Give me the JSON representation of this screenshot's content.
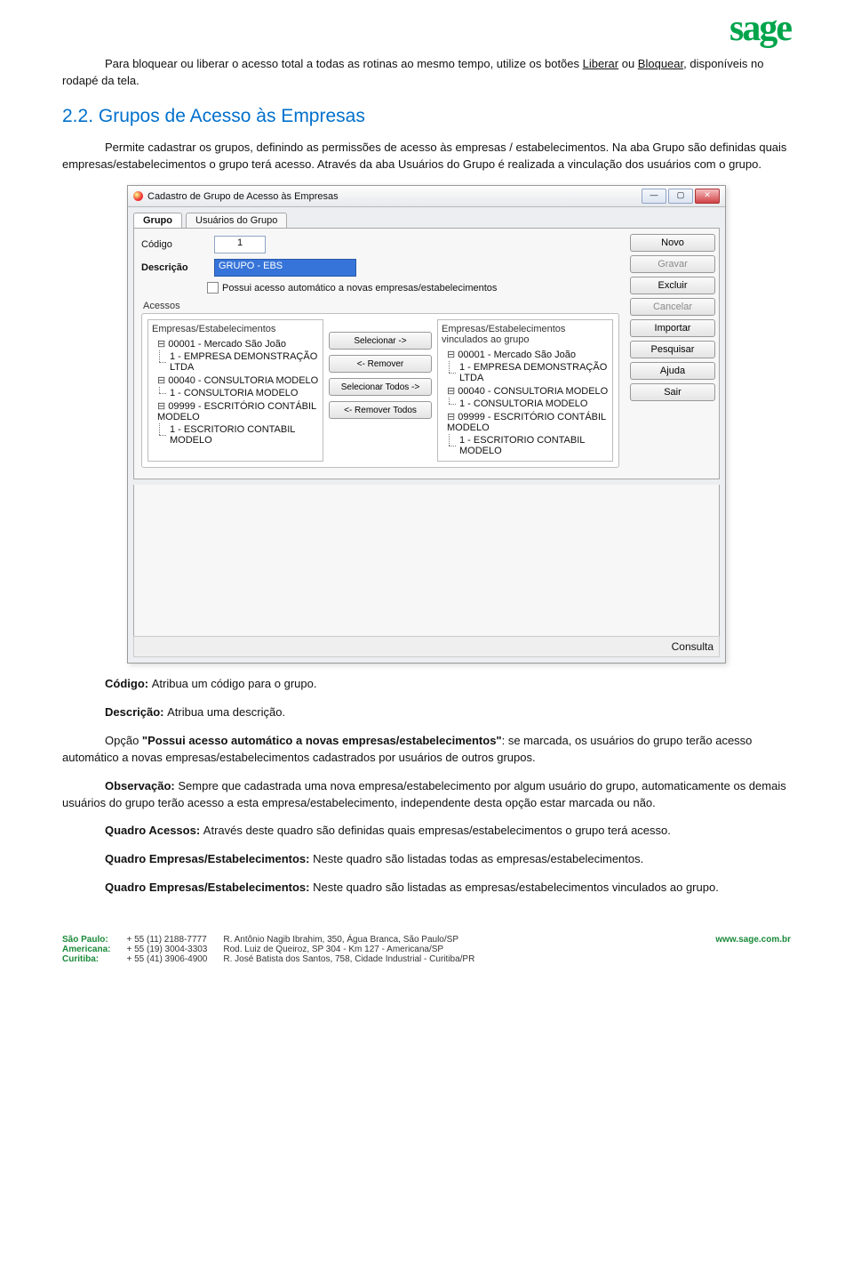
{
  "header": {
    "logo": "sage"
  },
  "doc": {
    "p1a": "Para bloquear ou liberar o acesso total a todas as rotinas ao mesmo tempo, utilize os botões ",
    "p1_liberar": "Liberar",
    "p1b": " ou ",
    "p1_bloquear": "Bloquear",
    "p1c": ", disponíveis no rodapé da tela.",
    "h2": "2.2.    Grupos de Acesso às Empresas",
    "p2": "Permite cadastrar os grupos, definindo as permissões de acesso às empresas / estabelecimentos. Na aba Grupo são definidas quais empresas/estabelecimentos o grupo terá acesso. Através da aba Usuários do Grupo é realizada a vinculação dos usuários com o grupo.",
    "codigo_label": "Código: ",
    "codigo_text": "Atribua um código para o grupo.",
    "descricao_label": "Descrição: ",
    "descricao_text": "Atribua uma descrição.",
    "opcao_prefix": "Opção ",
    "opcao_bold": "\"Possui acesso automático a novas empresas/estabelecimentos\"",
    "opcao_text": ": se marcada, os usuários do grupo terão acesso automático a novas empresas/estabelecimentos cadastrados por usuários de outros grupos.",
    "obs_label": "Observação: ",
    "obs_text": "Sempre que cadastrada uma nova empresa/estabelecimento por algum usuário do grupo, automaticamente os demais usuários do grupo terão acesso a esta empresa/estabelecimento, independente desta opção estar marcada ou não.",
    "qacessos_label": "Quadro Acessos: ",
    "qacessos_text": "Através deste quadro são definidas quais empresas/estabelecimentos o grupo terá acesso.",
    "qemp1_label": "Quadro Empresas/Estabelecimentos: ",
    "qemp1_text": "Neste quadro são listadas todas as empresas/estabelecimentos.",
    "qemp2_label": "Quadro Empresas/Estabelecimentos: ",
    "qemp2_text": "Neste quadro são listadas as empresas/estabelecimentos vinculados ao grupo."
  },
  "shot": {
    "title": "Cadastro de Grupo de Acesso às Empresas",
    "win_min": "—",
    "win_max": "▢",
    "win_close": "✕",
    "tabs": [
      "Grupo",
      "Usuários do Grupo"
    ],
    "form": {
      "codigo_label": "Código",
      "codigo_value": "1",
      "desc_label": "Descrição",
      "desc_value": "GRUPO - EBS",
      "checkbox_label": "Possui acesso automático a novas empresas/estabelecimentos",
      "acessos_label": "Acessos"
    },
    "trees": {
      "left_header": "Empresas/Estabelecimentos",
      "right_header": "Empresas/Estabelecimentos vinculados ao grupo",
      "left": [
        {
          "root": "00001 - Mercado São João",
          "child": "1 - EMPRESA DEMONSTRAÇÃO LTDA"
        },
        {
          "root": "00040 - CONSULTORIA MODELO",
          "child": "1 - CONSULTORIA MODELO"
        },
        {
          "root": "09999 - ESCRITÓRIO CONTÁBIL MODELO",
          "child": "1 - ESCRITORIO CONTABIL MODELO"
        }
      ],
      "right": [
        {
          "root": "00001 - Mercado São João",
          "child": "1 - EMPRESA DEMONSTRAÇÃO LTDA"
        },
        {
          "root": "00040 - CONSULTORIA MODELO",
          "child": "1 - CONSULTORIA MODELO"
        },
        {
          "root": "09999 - ESCRITÓRIO CONTÁBIL MODELO",
          "child": "1 - ESCRITORIO CONTABIL MODELO"
        }
      ]
    },
    "center": [
      "Selecionar ->",
      "<- Remover",
      "Selecionar Todos ->",
      "<- Remover Todos"
    ],
    "side": [
      "Novo",
      "Gravar",
      "Excluir",
      "Cancelar",
      "Importar",
      "Pesquisar",
      "Ajuda",
      "Sair"
    ],
    "status": "Consulta"
  },
  "footer": {
    "cities": [
      "São Paulo:",
      "Americana:",
      "Curitiba:"
    ],
    "phones": [
      "+ 55 (11) 2188-7777",
      "+ 55 (19) 3004-3303",
      "+ 55 (41) 3906-4900"
    ],
    "addr": [
      "R. Antônio Nagib Ibrahim, 350, Água Branca, São Paulo/SP",
      "Rod. Luiz de Queiroz, SP 304 - Km 127 - Americana/SP",
      "R. José Batista dos Santos, 758, Cidade Industrial - Curitiba/PR"
    ],
    "site": "www.sage.com.br"
  }
}
